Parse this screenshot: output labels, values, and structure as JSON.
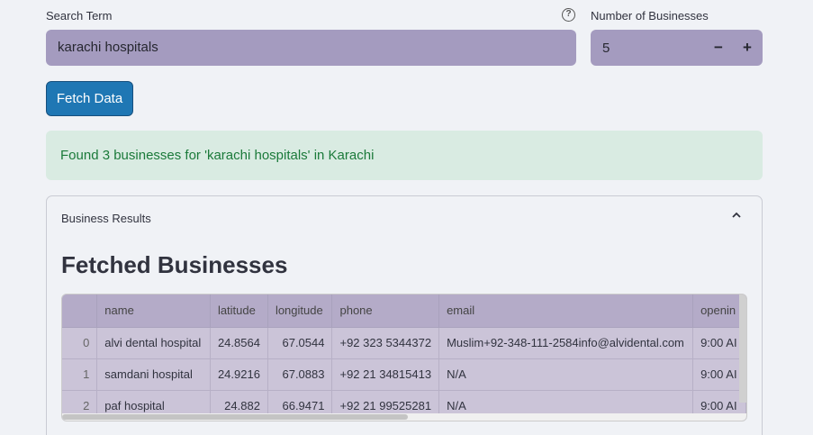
{
  "search": {
    "label": "Search Term",
    "value": "karachi hospitals"
  },
  "count": {
    "label": "Number of Businesses",
    "value": "5",
    "minus": "−",
    "plus": "+"
  },
  "fetch_button": "Fetch Data",
  "success_message": "Found 3 businesses for 'karachi hospitals' in Karachi",
  "expander": {
    "title": "Business Results",
    "heading": "Fetched Businesses"
  },
  "table": {
    "columns": [
      "",
      "name",
      "latitude",
      "longitude",
      "phone",
      "email",
      "openin"
    ],
    "rows": [
      [
        "0",
        "alvi dental hospital",
        "24.8564",
        "67.0544",
        "+92 323 5344372",
        "Muslim+92-348-111-2584info@alvidental.com",
        "9:00 AI"
      ],
      [
        "1",
        "samdani hospital",
        "24.9216",
        "67.0883",
        "+92 21 34815413",
        "N/A",
        "9:00 AI"
      ],
      [
        "2",
        "paf hospital",
        "24.882",
        "66.9471",
        "+92 21 99525281",
        "N/A",
        "9:00 AI"
      ]
    ]
  }
}
